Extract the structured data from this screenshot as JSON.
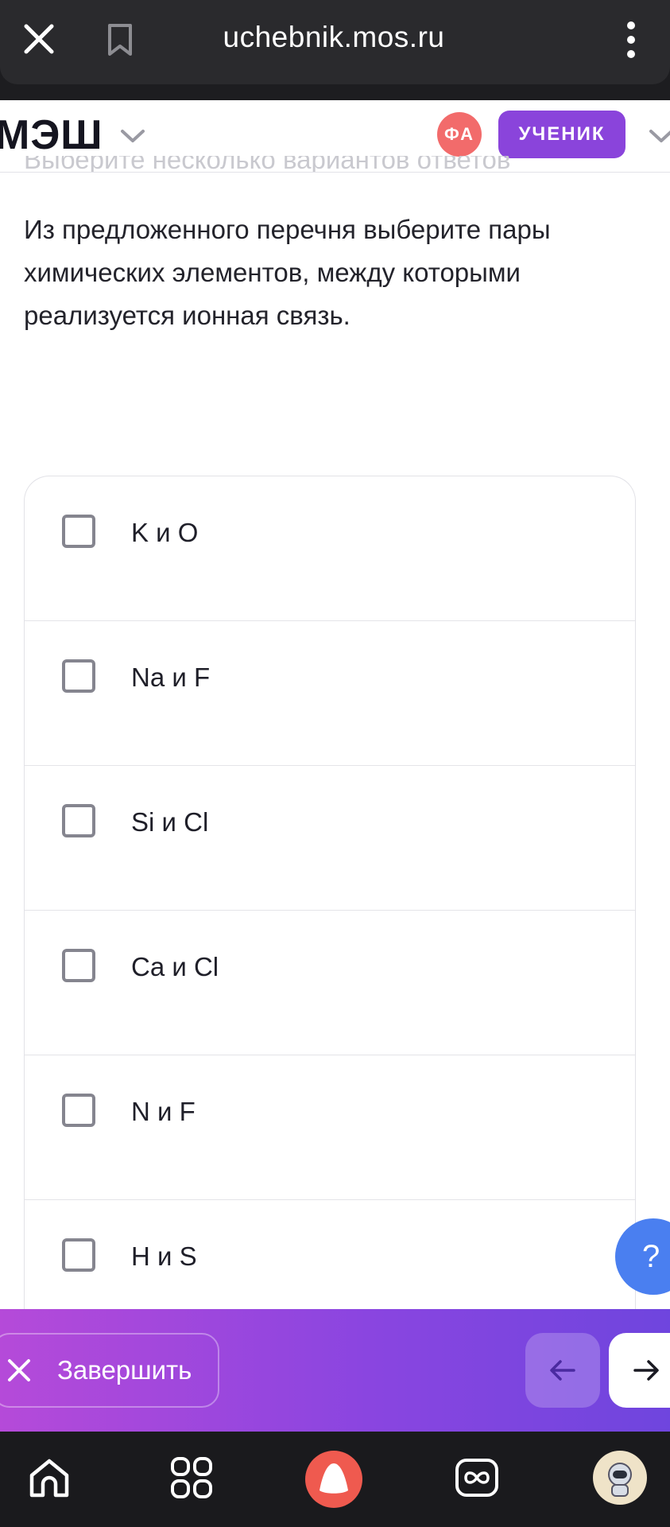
{
  "browser": {
    "url": "uchebnik.mos.ru"
  },
  "header": {
    "logo": "МЭШ",
    "avatar_initials": "ФА",
    "role_badge": "УЧЕНИК"
  },
  "task": {
    "faded_instruction": "Выберите несколько вариантов ответов",
    "question": "Из предложенного перечня выберите пары химических элементов, между которыми реализуется ионная связь."
  },
  "options": [
    {
      "label": "K и O",
      "checked": false
    },
    {
      "label": "Na и F",
      "checked": false
    },
    {
      "label": "Si и Cl",
      "checked": false
    },
    {
      "label": "Ca и Cl",
      "checked": false
    },
    {
      "label": "N и F",
      "checked": false
    },
    {
      "label": "H и S",
      "checked": false
    }
  ],
  "help": {
    "label": "?"
  },
  "action_bar": {
    "finish_label": "Завершить"
  },
  "icons": {
    "close": "close-icon",
    "bookmark": "bookmark-icon",
    "more": "more-vertical-icon",
    "home": "home-icon",
    "apps": "apps-grid-icon",
    "alice": "alice-assistant-icon",
    "infinity": "infinity-icon",
    "profile": "profile-avatar-icon"
  },
  "colors": {
    "accent": "#8a44db",
    "avatar": "#f26b6b",
    "help": "#4a7ff0",
    "alice": "#ef5a4f"
  }
}
